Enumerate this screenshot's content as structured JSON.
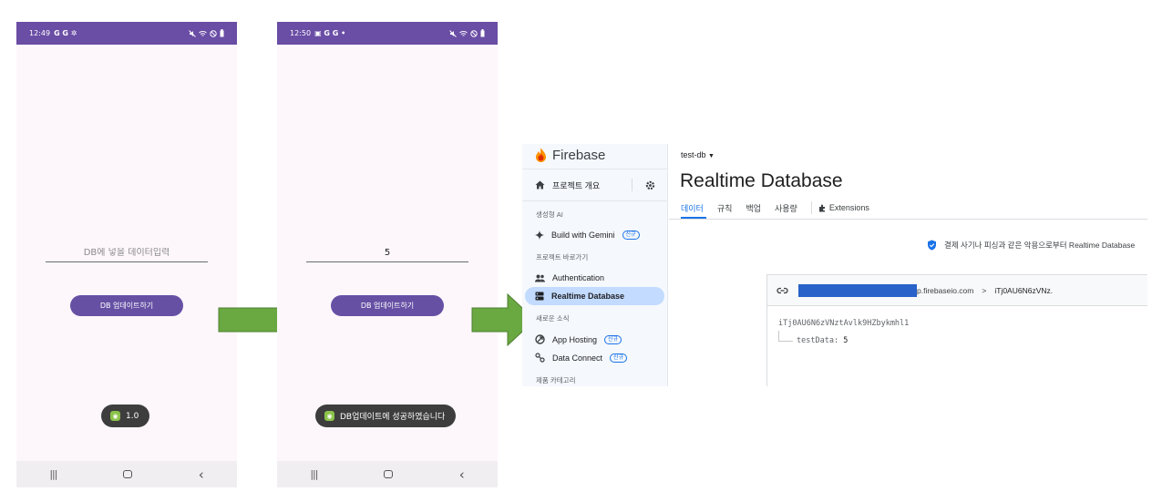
{
  "phone_before": {
    "status": {
      "time": "12:49",
      "glyphs": "G G ✲"
    },
    "input": {
      "placeholder": "DB에 넣을 데이터입력",
      "value": ""
    },
    "button_label": "DB 업데이트하기",
    "toast": "1.0"
  },
  "phone_after": {
    "status": {
      "time": "12:50",
      "glyphs": "▣ G G •"
    },
    "input": {
      "placeholder": "",
      "value": "5"
    },
    "button_label": "DB 업데이트하기",
    "toast": "DB업데이트에 성공하였습니다"
  },
  "nav": {
    "recent": "|||",
    "back": "‹"
  },
  "colors": {
    "status_bar": "#6a4da5",
    "button": "#6650a4",
    "arrow": "#6aa842",
    "firebase_blue": "#1a73e8"
  },
  "firebase": {
    "logo_text": "Firebase",
    "overview": "프로젝트 개요",
    "sections": {
      "gen_ai": "생성형 AI",
      "shortcuts": "프로젝트 바로가기",
      "news": "새로운 소식",
      "categories": "제품 카테고리"
    },
    "items": {
      "gemini": "Build with Gemini",
      "auth": "Authentication",
      "rtdb": "Realtime Database",
      "hosting": "App Hosting",
      "dataconnect": "Data Connect"
    },
    "badge_new": "신규",
    "project": "test-db",
    "page_title": "Realtime Database",
    "tabs": [
      "데이터",
      "규칙",
      "백업",
      "사용량",
      "Extensions"
    ],
    "notice": "결제 사기나 피싱과 같은 악용으로부터 Realtime Database",
    "url_suffix": "p.firebaseio.com",
    "breadcrumb_sep": ">",
    "breadcrumb_key": "iTj0AU6N6zVNz.",
    "root_key": "iTj0AU6N6zVNztAvlk9HZbykmhl1",
    "child_key": "testData:",
    "child_value": "5"
  }
}
